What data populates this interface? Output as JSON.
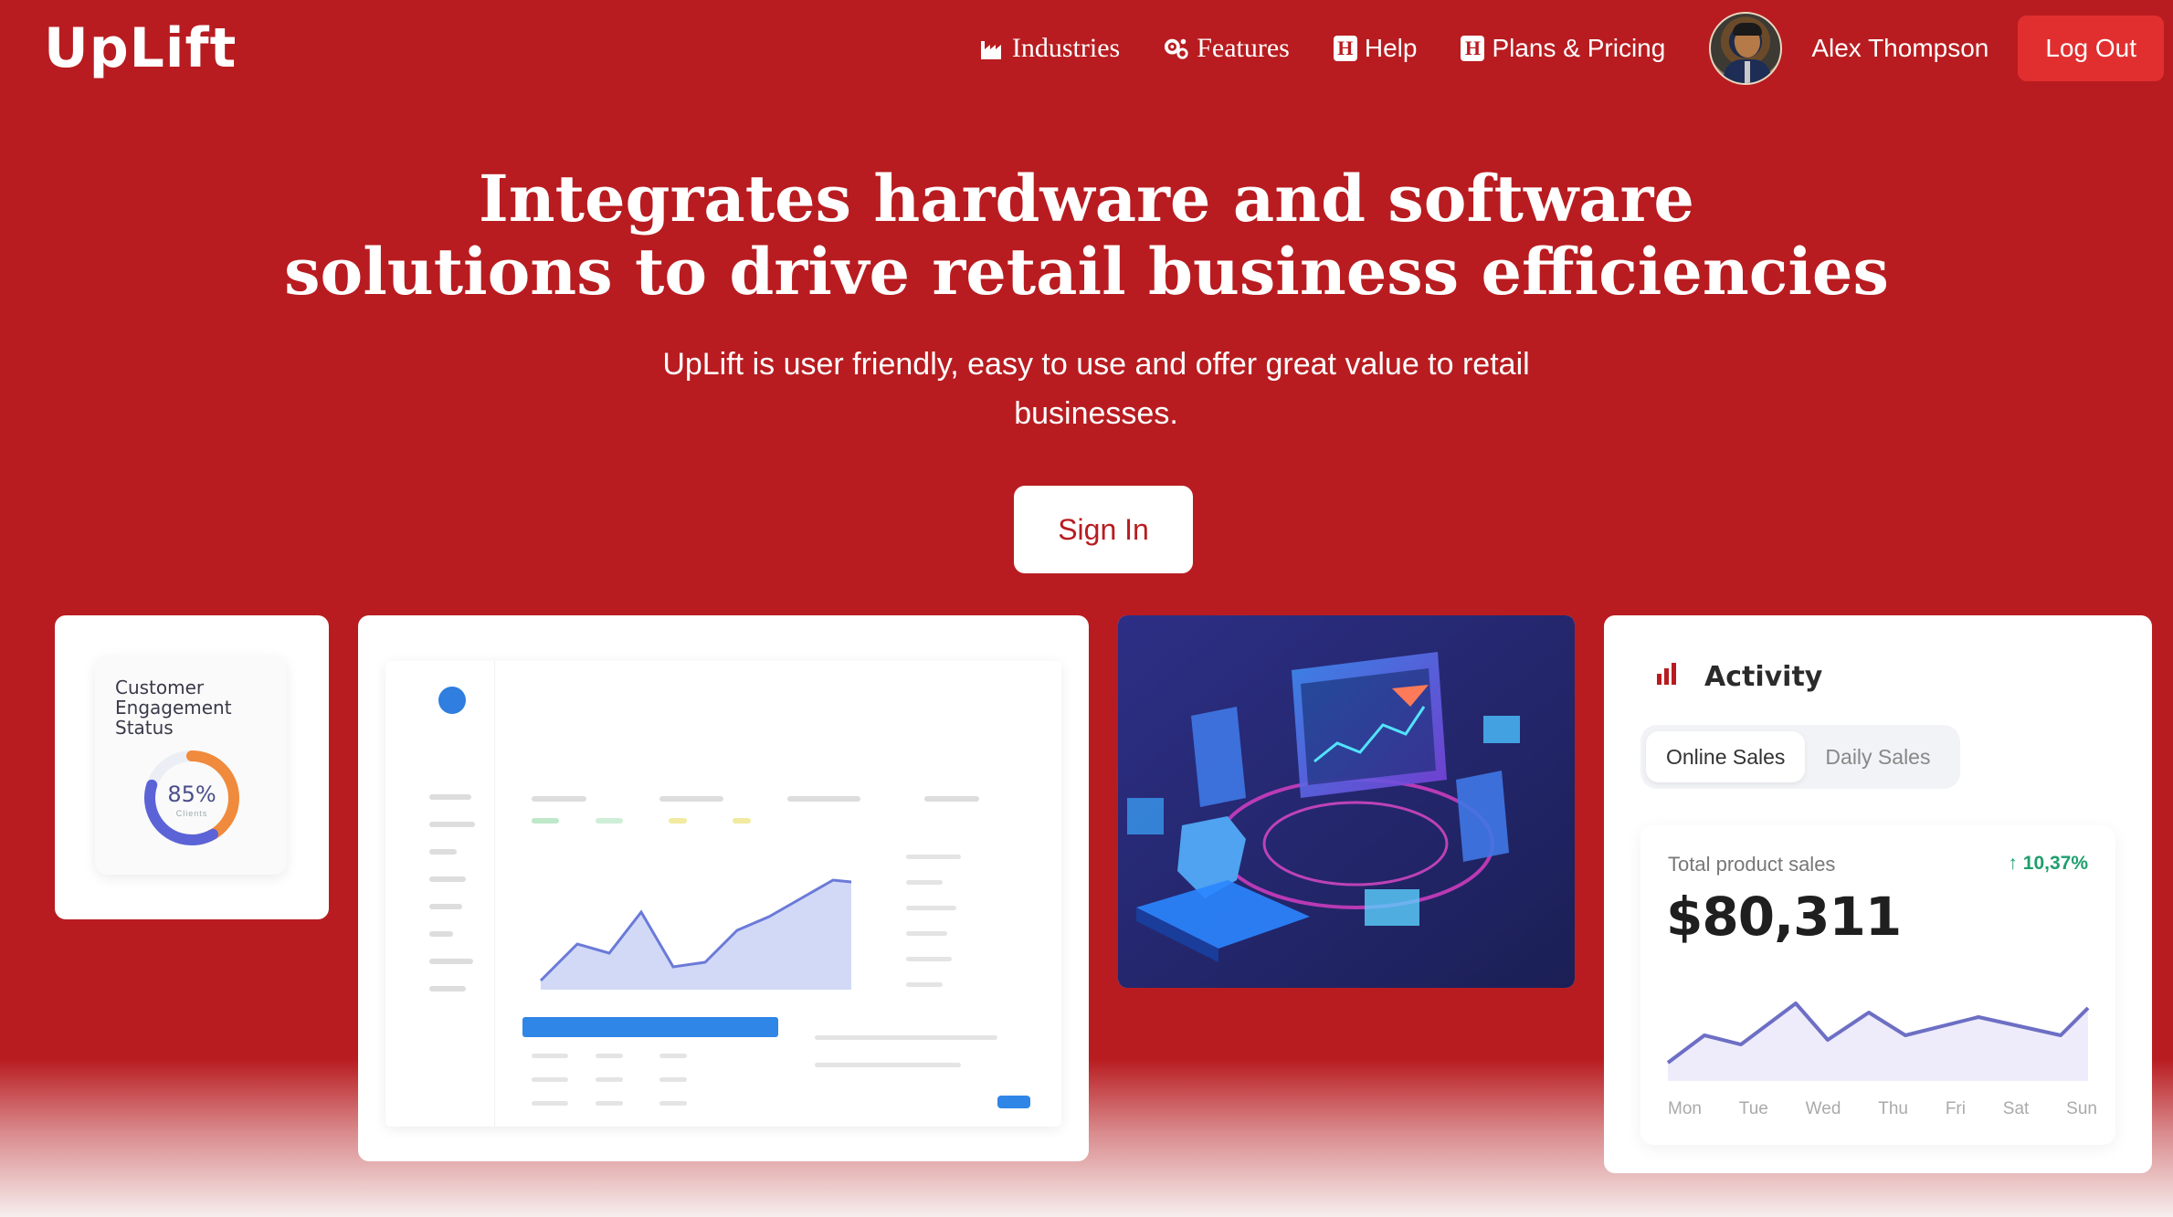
{
  "brand": {
    "logo": "UpLift"
  },
  "nav": {
    "industries": "Industries",
    "features": "Features",
    "help": "Help",
    "pricing": "Plans & Pricing",
    "user_name": "Alex Thompson",
    "logout": "Log Out"
  },
  "hero": {
    "title_line1": "Integrates hardware and software",
    "title_line2": "solutions to drive retail business efficiencies",
    "subtitle": "UpLift is user friendly, easy to use and offer great value to retail businesses.",
    "cta": "Sign In"
  },
  "engagement_card": {
    "title": "Customer Engagement Status",
    "value": "85%",
    "value_fraction": 0.85,
    "sublabel": "Clients"
  },
  "activity_card": {
    "title": "Activity",
    "tabs": [
      "Online Sales",
      "Daily Sales"
    ],
    "active_tab": "Online Sales",
    "total_label": "Total product sales",
    "change": "10,37%",
    "total_value": "$80,311",
    "days": [
      "Mon",
      "Tue",
      "Wed",
      "Thu",
      "Fri",
      "Sat",
      "Sun"
    ]
  },
  "colors": {
    "brand_red": "#b81c20",
    "logout_red": "#e12f2f",
    "positive_green": "#1f9e6e",
    "chart_purple": "#6c6fc4",
    "donut_blue": "#5b63d6",
    "donut_orange": "#f08a3c"
  }
}
